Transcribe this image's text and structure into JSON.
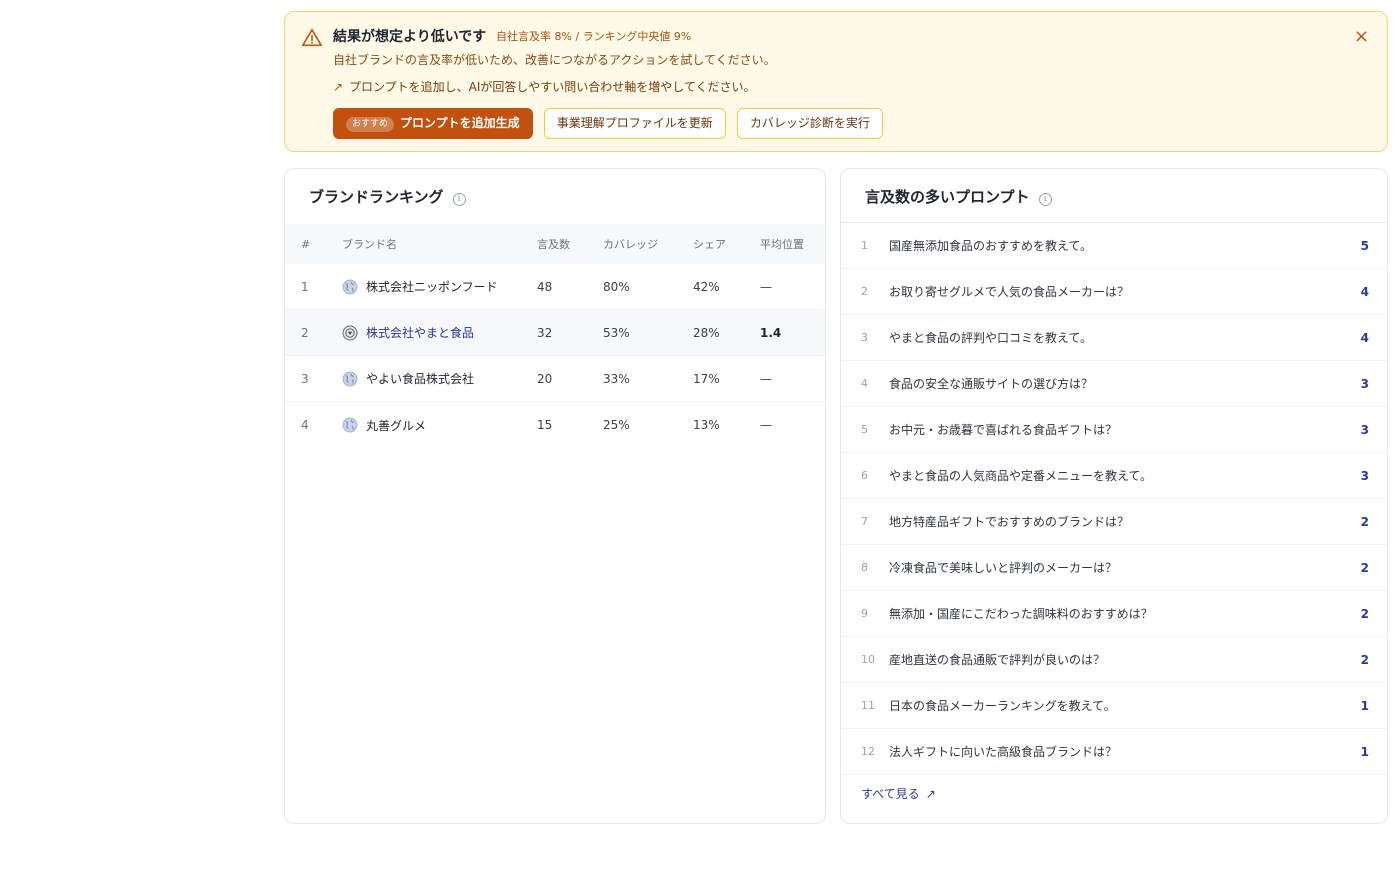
{
  "alert": {
    "title": "結果が想定より低いです",
    "meta": "自社言及率 8% / ランキング中央値 9%",
    "description": "自社ブランドの言及率が低いため、改善につながるアクションを試してください。",
    "tip": "プロンプトを追加し、AIが回答しやすい問い合わせ軸を増やしてください。",
    "close_label": "×",
    "buttons": {
      "recommend_badge": "おすすめ",
      "generate_prompts": "プロンプトを追加生成",
      "update_profile": "事業理解プロファイルを更新",
      "run_diagnosis": "カバレッジ診断を実行"
    },
    "accent_color": "#c2500e"
  },
  "ranking": {
    "title": "ブランドランキング",
    "columns": {
      "rank": "#",
      "brand": "ブランド名",
      "mentions": "言及数",
      "coverage": "カバレッジ",
      "share": "シェア",
      "avg_position": "平均位置"
    },
    "rows": [
      {
        "rank": "1",
        "brand": "株式会社ニッポンフード",
        "icon": "globe-icon",
        "mentions": "48",
        "coverage": "80%",
        "share": "42%",
        "avg_position": "—"
      },
      {
        "rank": "2",
        "brand": "株式会社やまと食品",
        "icon": "own-brand-icon",
        "mentions": "32",
        "coverage": "53%",
        "share": "28%",
        "avg_position": "1.4"
      },
      {
        "rank": "3",
        "brand": "やよい食品株式会社",
        "icon": "globe-icon",
        "mentions": "20",
        "coverage": "33%",
        "share": "17%",
        "avg_position": "—"
      },
      {
        "rank": "4",
        "brand": "丸善グルメ",
        "icon": "globe-icon",
        "mentions": "15",
        "coverage": "25%",
        "share": "13%",
        "avg_position": "—"
      }
    ]
  },
  "prompts": {
    "title": "言及数の多いプロンプト",
    "items": [
      {
        "num": "1",
        "text": "国産無添加食品のおすすめを教えて。",
        "count": "5"
      },
      {
        "num": "2",
        "text": "お取り寄せグルメで人気の食品メーカーは？",
        "count": "4"
      },
      {
        "num": "3",
        "text": "やまと食品の評判や口コミを教えて。",
        "count": "4"
      },
      {
        "num": "4",
        "text": "食品の安全な通販サイトの選び方は？",
        "count": "3"
      },
      {
        "num": "5",
        "text": "お中元・お歳暮で喜ばれる食品ギフトは？",
        "count": "3"
      },
      {
        "num": "6",
        "text": "やまと食品の人気商品や定番メニューを教えて。",
        "count": "3"
      },
      {
        "num": "7",
        "text": "地方特産品ギフトでおすすめのブランドは？",
        "count": "2"
      },
      {
        "num": "8",
        "text": "冷凍食品で美味しいと評判のメーカーは？",
        "count": "2"
      },
      {
        "num": "9",
        "text": "無添加・国産にこだわった調味料のおすすめは？",
        "count": "2"
      },
      {
        "num": "10",
        "text": "産地直送の食品通販で評判が良いのは？",
        "count": "2"
      },
      {
        "num": "11",
        "text": "日本の食品メーカーランキングを教えて。",
        "count": "1"
      },
      {
        "num": "12",
        "text": "法人ギフトに向いた高級食品ブランドは？",
        "count": "1"
      }
    ],
    "see_all": "すべて見る"
  }
}
